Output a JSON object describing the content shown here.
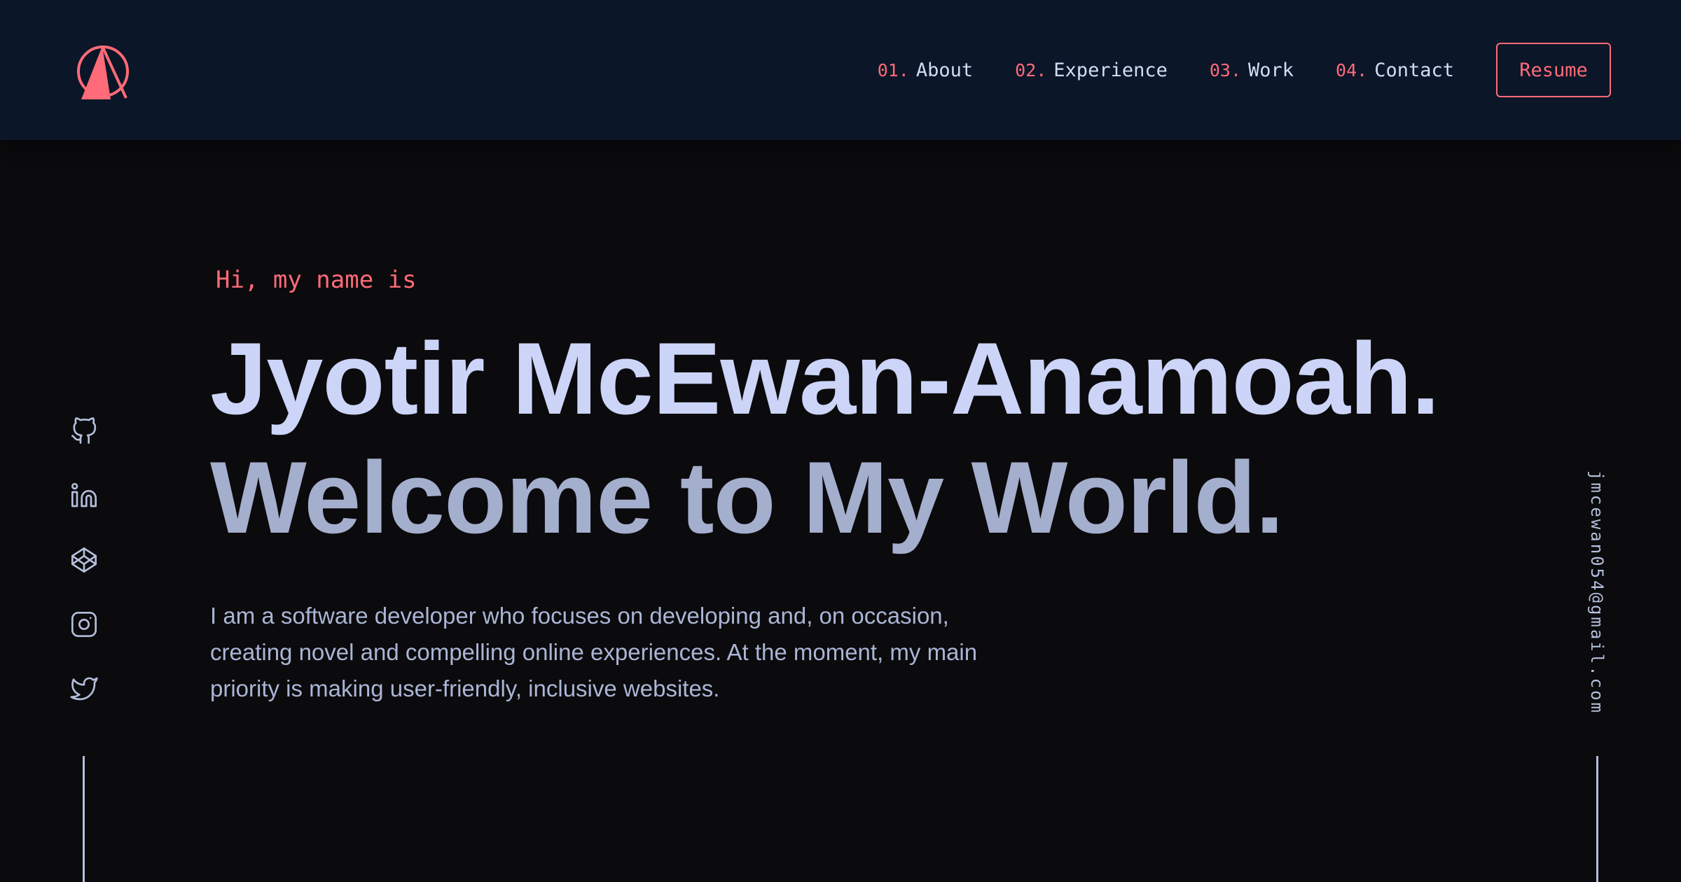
{
  "header": {
    "logo_icon": "triangle-circle-logo-icon",
    "nav": [
      {
        "num": "01.",
        "label": "About"
      },
      {
        "num": "02.",
        "label": "Experience"
      },
      {
        "num": "03.",
        "label": "Work"
      },
      {
        "num": "04.",
        "label": "Contact"
      }
    ],
    "resume_label": "Resume"
  },
  "social": [
    {
      "name": "github-icon"
    },
    {
      "name": "linkedin-icon"
    },
    {
      "name": "codepen-icon"
    },
    {
      "name": "instagram-icon"
    },
    {
      "name": "twitter-icon"
    }
  ],
  "hero": {
    "intro": "Hi, my name is",
    "name": "Jyotir McEwan-Anamoah.",
    "tagline": "Welcome to My World.",
    "description": "I am a software developer who focuses on developing and, on occasion, creating novel and compelling online experiences. At the moment, my main priority is making user-friendly, inclusive websites."
  },
  "email": "jmcewan054@gmail.com",
  "colors": {
    "accent": "#ff6b78",
    "header_bg": "#0b1628",
    "page_bg": "#0b0a0c",
    "text_light": "#ccd5f8",
    "text_muted": "#aab5d6"
  }
}
